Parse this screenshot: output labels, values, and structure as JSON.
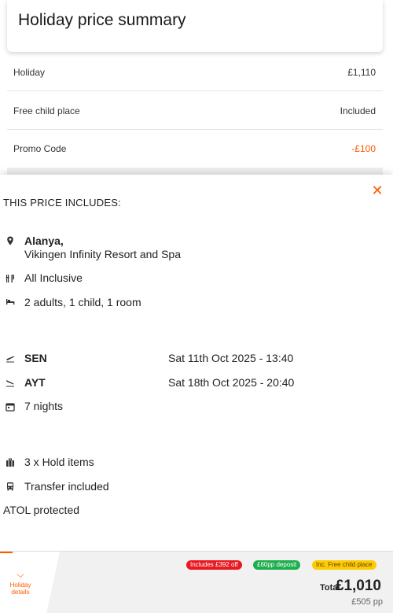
{
  "summary": {
    "title": "Holiday price summary",
    "rows": [
      {
        "label": "Holiday",
        "value": "£1,110"
      },
      {
        "label": "Free child place",
        "value": "Included"
      },
      {
        "label": "Promo Code",
        "value": "-£100"
      }
    ]
  },
  "includes": {
    "heading": "THIS PRICE INCLUDES:",
    "close_icon": "close-icon",
    "location": {
      "city": "Alanya,",
      "hotel": "Vikingen Infinity Resort and Spa",
      "icon": "map-pin-icon"
    },
    "board": {
      "text": "All Inclusive",
      "icon": "cutlery-icon"
    },
    "room": {
      "text": "2 adults, 1 child, 1 room",
      "icon": "bed-icon"
    },
    "outbound": {
      "airport": "SEN",
      "datetime": "Sat 11th Oct 2025 - 13:40",
      "icon": "plane-departure-icon"
    },
    "inbound": {
      "airport": "AYT",
      "datetime": "Sat 18th Oct 2025 - 20:40",
      "icon": "plane-arrival-icon"
    },
    "nights": {
      "text": "7 nights",
      "icon": "calendar-icon"
    },
    "luggage": {
      "text": "3 x Hold items",
      "icon": "luggage-icon"
    },
    "transfer": {
      "text": "Transfer included",
      "icon": "bus-icon"
    },
    "atol": "ATOL protected"
  },
  "bottom_bar": {
    "details_label": "Holiday details",
    "badges": [
      {
        "text": "Includes £392 off",
        "color": "#e8191f"
      },
      {
        "text": "£60pp deposit",
        "color": "#1fae4e"
      },
      {
        "text": "Inc. Free child place",
        "color": "#ffcb05"
      }
    ],
    "total_label": "Total",
    "total_value": "£1,010",
    "per_person": "£505 pp"
  },
  "colors": {
    "accent": "#ff5a00"
  }
}
